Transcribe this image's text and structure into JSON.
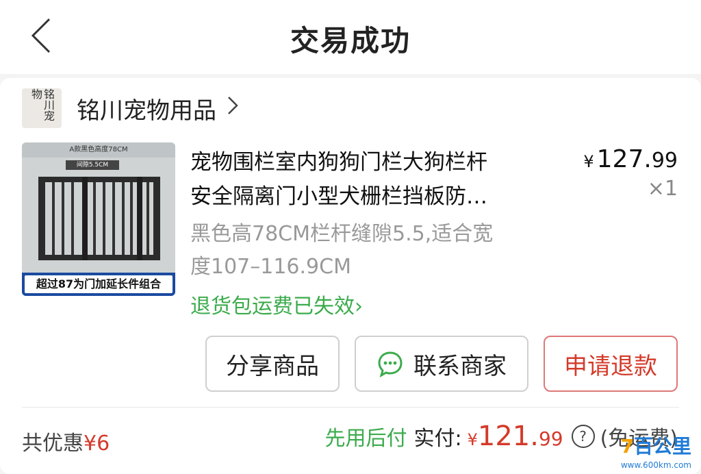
{
  "header": {
    "title": "交易成功"
  },
  "shop": {
    "logo_text": "铭川宠物",
    "name": "铭川宠物用品"
  },
  "product": {
    "image_top_text": "A款黑色高度78CM",
    "image_tag": "间隙5.5CM",
    "image_banner": "超过87为门加延长件组合",
    "title_line1": "宠物围栏室内狗狗门栏大狗栏杆",
    "title_line2": "安全隔离门小型犬栅栏挡板防…",
    "price_symbol": "¥",
    "price_int": "127.",
    "price_dec": "99",
    "quantity": "×1",
    "spec_line1": "黑色高78CM栏杆缝隙5.5,适合宽",
    "spec_line2": "度107–116.9CM",
    "return_shipping": "退货包运费已失效",
    "return_shipping_chevron": "›"
  },
  "actions": {
    "share": "分享商品",
    "contact": "联系商家",
    "refund": "申请退款"
  },
  "summary": {
    "discount_label": "共优惠",
    "discount_amount": "¥6",
    "pay_later": "先用后付",
    "paid_label": "实付:",
    "paid_symbol": "¥",
    "paid_int": "121.",
    "paid_dec": "99",
    "help": "?",
    "shipping_note": "(免运费)"
  },
  "watermark": {
    "logo_digit": "7",
    "logo_text": "百公里",
    "url": "www.600km.com"
  },
  "colors": {
    "accent_red": "#d43a2a",
    "accent_green": "#3bab4b",
    "watermark_blue": "#1f7bd6"
  }
}
